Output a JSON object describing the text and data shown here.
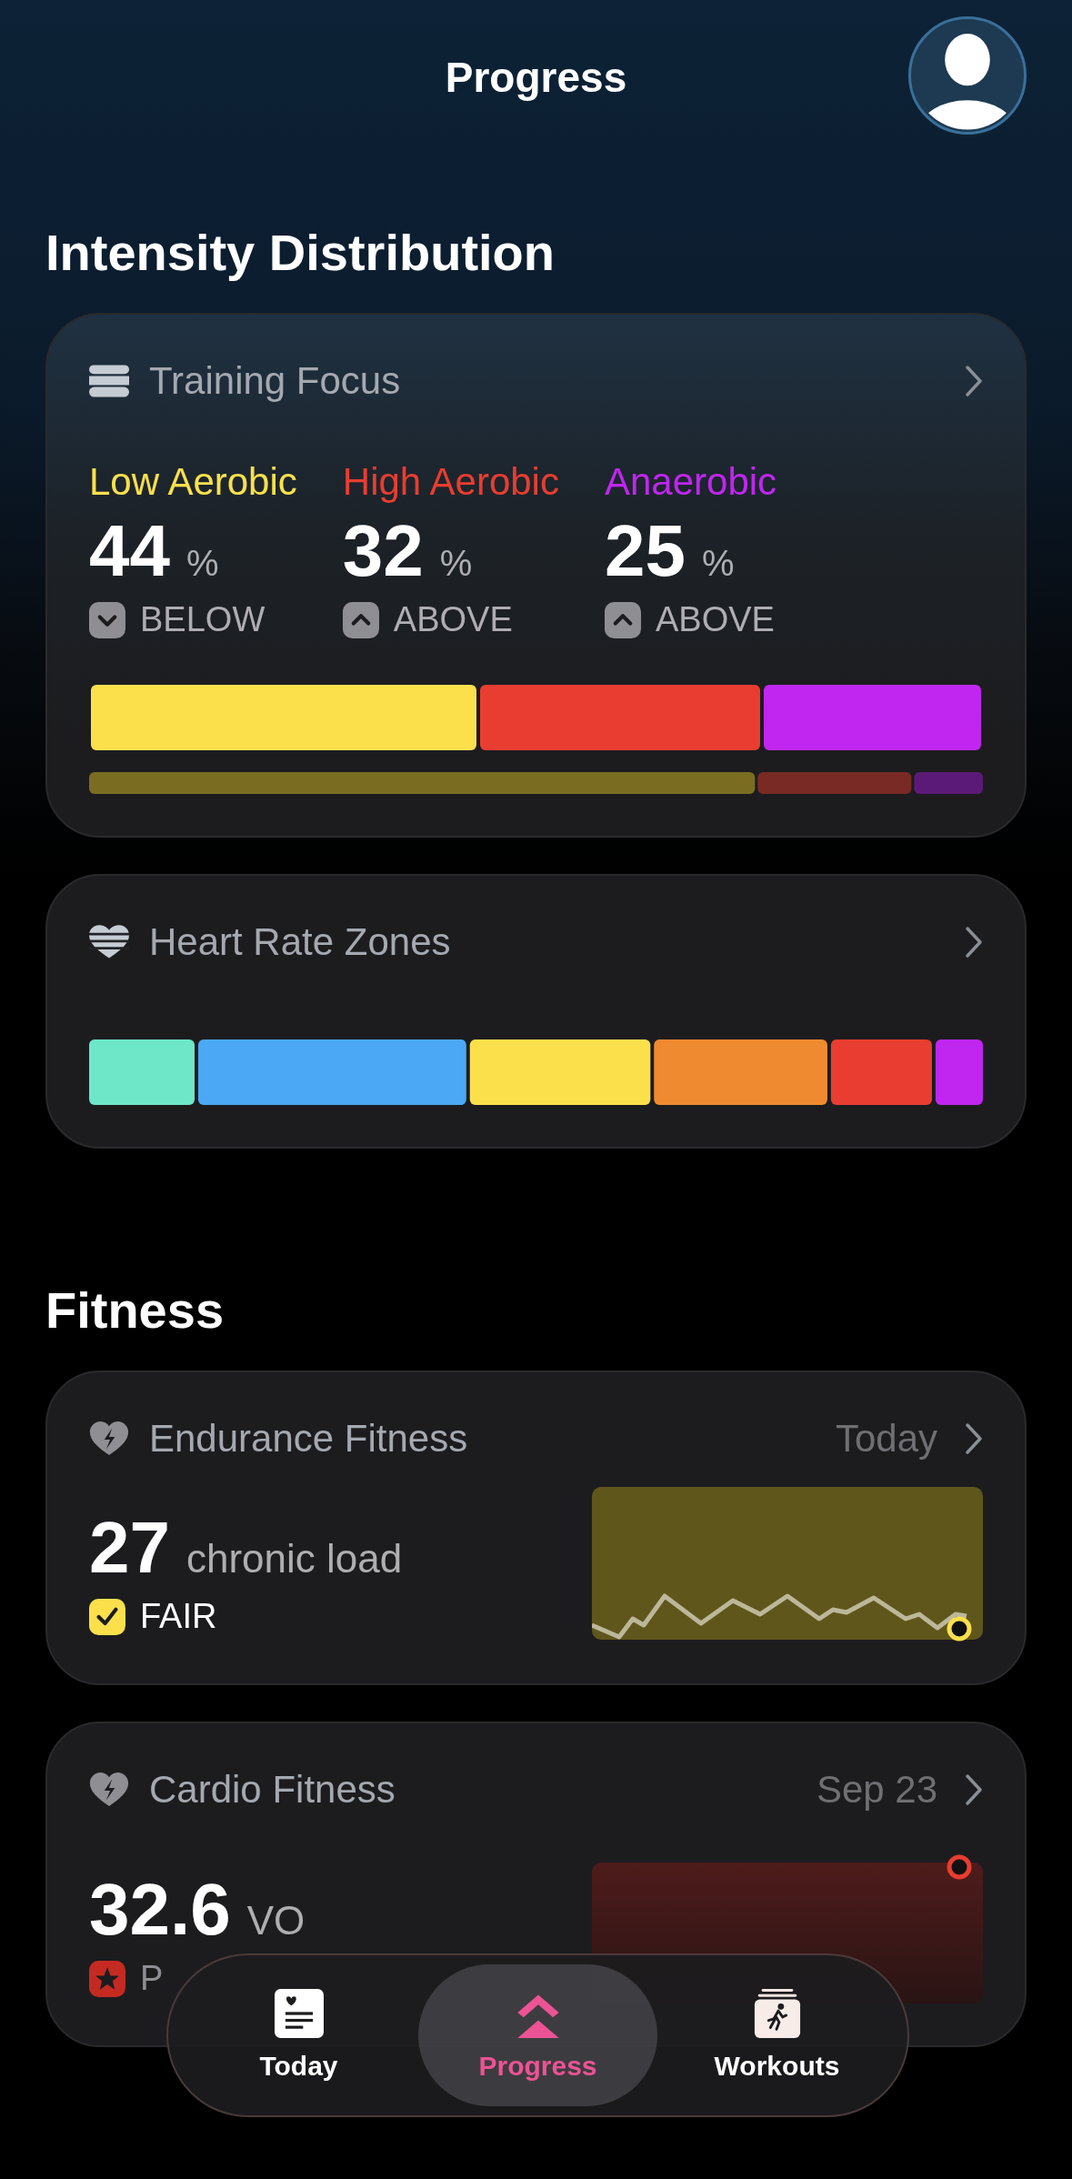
{
  "header": {
    "title": "Progress"
  },
  "intensity": {
    "heading": "Intensity Distribution",
    "card": {
      "title": "Training Focus",
      "zones": [
        {
          "label": "Low Aerobic",
          "value": "44",
          "unit": "%",
          "status": "BELOW",
          "kind": "down",
          "color": "#fbe04c"
        },
        {
          "label": "High Aerobic",
          "value": "32",
          "unit": "%",
          "status": "ABOVE",
          "kind": "up",
          "color": "#e83d30"
        },
        {
          "label": "Anaerobic",
          "value": "25",
          "unit": "%",
          "status": "ABOVE",
          "kind": "up",
          "color": "#c026f0"
        }
      ]
    },
    "hr_card": {
      "title": "Heart Rate Zones"
    }
  },
  "fitness": {
    "heading": "Fitness",
    "cards": [
      {
        "kind": "endurance",
        "title": "Endurance Fitness",
        "date": "Today",
        "value": "27",
        "unit": "chronic load",
        "rating": {
          "text": "FAIR",
          "kind": "check",
          "color": "#fbe04c"
        }
      },
      {
        "kind": "cardio",
        "title": "Cardio Fitness",
        "date": "Sep 23",
        "value": "32.6",
        "unit": "VO",
        "rating": {
          "text": "P",
          "kind": "star",
          "color": "#c42a22"
        }
      }
    ]
  },
  "tab_bar": [
    {
      "label": "Today",
      "selected": false
    },
    {
      "label": "Progress",
      "selected": true
    },
    {
      "label": "Workouts",
      "selected": false
    }
  ]
}
